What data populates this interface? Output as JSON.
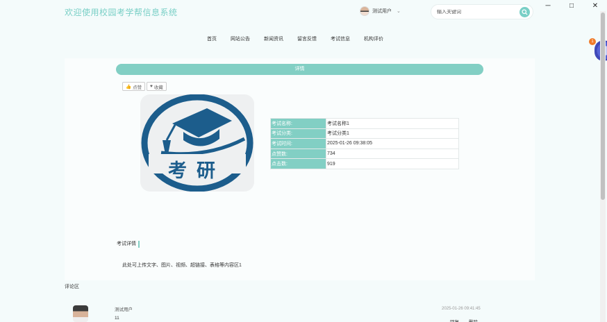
{
  "window": {
    "minimize": "─",
    "maximize": "□",
    "close": "✕"
  },
  "header": {
    "title": "欢迎使用校园考学帮信息系统",
    "user": "测试用户",
    "search_placeholder": "输入关键词"
  },
  "nav": [
    "首页",
    "网站公告",
    "新闻资讯",
    "留言反馈",
    "考试信息",
    "机构评价"
  ],
  "detail": {
    "bar_label": "详情",
    "like_label": "点赞",
    "collect_label": "收藏",
    "logo_text": "考研",
    "info": [
      {
        "key": "考试名称:",
        "value": "考试名称1"
      },
      {
        "key": "考试分类:",
        "value": "考试分类1"
      },
      {
        "key": "考试时间:",
        "value": "2025-01-26 09:38:05"
      },
      {
        "key": "点赞数:",
        "value": "734"
      },
      {
        "key": "点击数:",
        "value": "919"
      }
    ],
    "section_title": "考试详情",
    "detail_text": "此处可上传文字、图片、视频、超链接、表格等内容区1"
  },
  "comments": {
    "title": "评论区",
    "items": [
      {
        "user": "测试用户",
        "content": "11",
        "time": "2025-01-26 09:41:45",
        "action1": "回复",
        "action2": "删除"
      }
    ]
  },
  "widget": {
    "badge": "1"
  },
  "colors": {
    "accent": "#82cfc4",
    "title": "#79cfc6"
  }
}
